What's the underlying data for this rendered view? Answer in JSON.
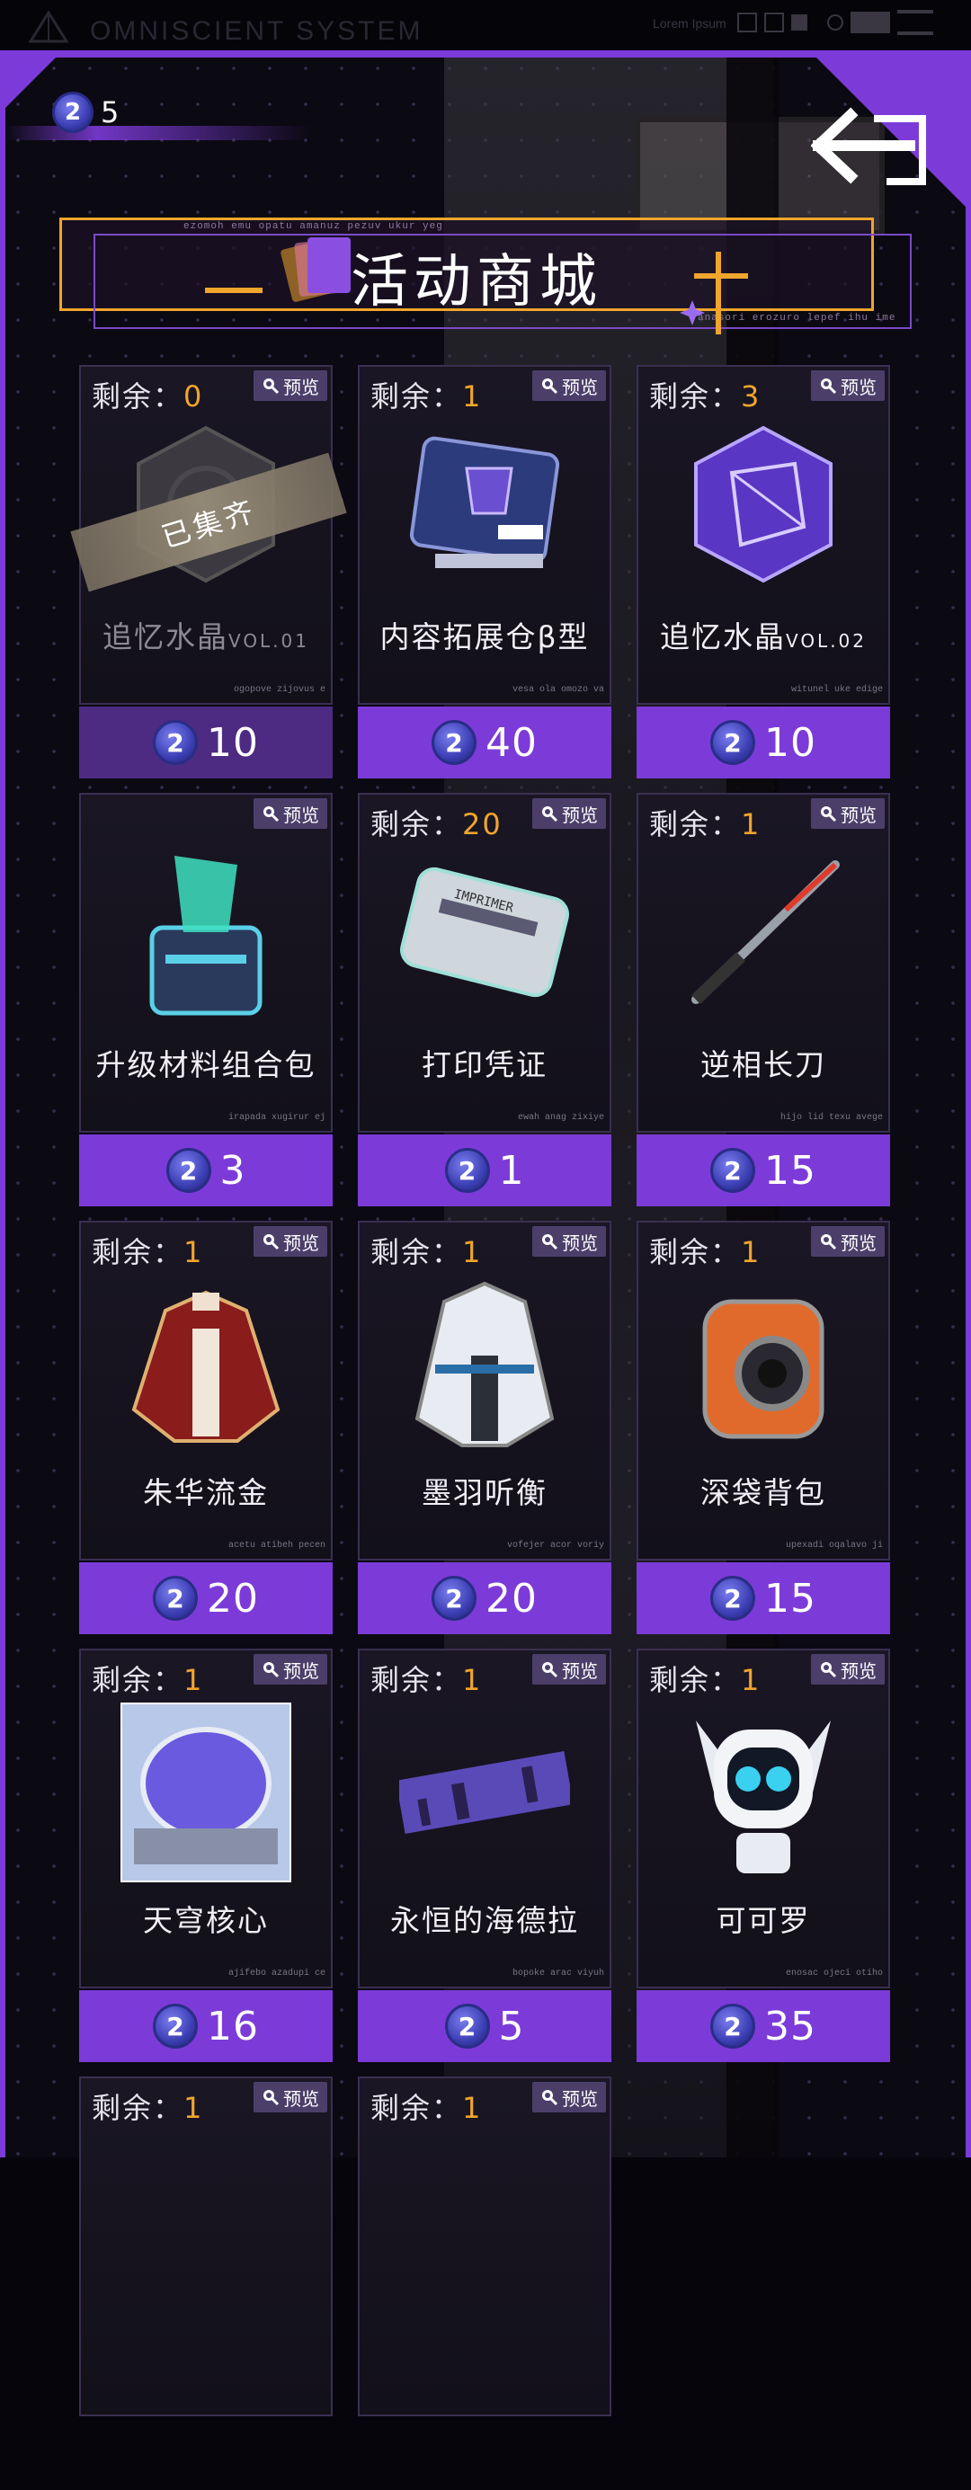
{
  "topbar": {
    "system_name": "OMNISCIENT SYSTEM",
    "small_label": "Lorem Ipsum"
  },
  "currency": {
    "coin_glyph": "2",
    "amount": "5"
  },
  "banner": {
    "title": "活动商城",
    "micro_top": "ezomoh emu opatu amanuz pezuv ukur yeg",
    "micro_bottom": "anasori erozuro lepef ihu ime"
  },
  "stock_prefix": "剩余：",
  "preview_label": "预览",
  "collected_label": "已集齐",
  "coin_glyph": "2",
  "colors": {
    "accent": "#7c3bd8",
    "gold": "#f0a52c",
    "coin": "#3b3fb3"
  },
  "items": [
    {
      "stock": "0",
      "name": "追忆水晶",
      "vol": "VOL.01",
      "price": "10",
      "tag": "ogopove zijovus e",
      "icon": "crystal-gray-icon"
    },
    {
      "stock": "1",
      "name": "内容拓展仓β型",
      "vol": "",
      "price": "40",
      "tag": "vesa ola omozo va",
      "icon": "chip-module-icon"
    },
    {
      "stock": "3",
      "name": "追忆水晶",
      "vol": "VOL.02",
      "price": "10",
      "tag": "witunel uke edige",
      "icon": "crystal-purple-icon"
    },
    {
      "stock": "",
      "name": "升级材料组合包",
      "vol": "",
      "price": "3",
      "tag": "irapada xugirur ej",
      "icon": "upgrade-box-icon"
    },
    {
      "stock": "20",
      "name": "打印凭证",
      "vol": "",
      "price": "1",
      "tag": "ewah anag zixiye",
      "icon": "print-ticket-icon"
    },
    {
      "stock": "1",
      "name": "逆相长刀",
      "vol": "",
      "price": "15",
      "tag": "hijo lid texu avege",
      "icon": "long-blade-icon"
    },
    {
      "stock": "1",
      "name": "朱华流金",
      "vol": "",
      "price": "20",
      "tag": "acetu atibeh pecen",
      "icon": "red-outfit-icon"
    },
    {
      "stock": "1",
      "name": "墨羽听衡",
      "vol": "",
      "price": "20",
      "tag": "vofejer acor voriy",
      "icon": "white-outfit-icon"
    },
    {
      "stock": "1",
      "name": "深袋背包",
      "vol": "",
      "price": "15",
      "tag": "upexadi oqalavo ji",
      "icon": "backpack-icon"
    },
    {
      "stock": "1",
      "name": "天穹核心",
      "vol": "",
      "price": "16",
      "tag": "ajifebo azadupi ce",
      "icon": "dome-core-icon"
    },
    {
      "stock": "1",
      "name": "永恒的海德拉",
      "vol": "",
      "price": "5",
      "tag": "bopoke arac viyuh",
      "icon": "city-banner-icon"
    },
    {
      "stock": "1",
      "name": "可可罗",
      "vol": "",
      "price": "35",
      "tag": "enosac ojeci otiho",
      "icon": "robot-mascot-icon"
    },
    {
      "stock": "1",
      "name": "",
      "vol": "",
      "price": "",
      "tag": "",
      "icon": ""
    },
    {
      "stock": "1",
      "name": "",
      "vol": "",
      "price": "",
      "tag": "",
      "icon": ""
    }
  ]
}
